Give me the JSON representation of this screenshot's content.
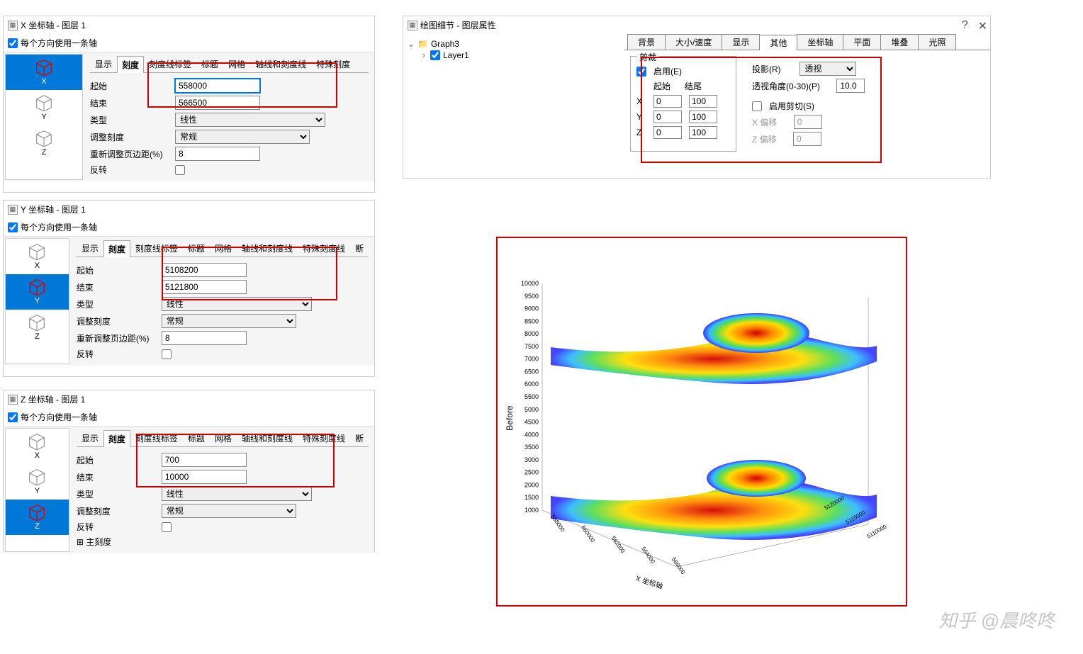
{
  "dialogs": {
    "x": {
      "title": "X 坐标轴 - 图层 1",
      "use_one": "每个方向使用一条轴",
      "axes": [
        "X",
        "Y",
        "Z"
      ],
      "selected": "X",
      "tabs": [
        "显示",
        "刻度",
        "刻度线标签",
        "标题",
        "网格",
        "轴线和刻度线",
        "特殊刻度"
      ],
      "active_tab": "刻度",
      "start_lbl": "起始",
      "start": "558000",
      "end_lbl": "结束",
      "end": "566500",
      "type_lbl": "类型",
      "type": "线性",
      "adjust_lbl": "调整刻度",
      "adjust": "常规",
      "margin_lbl": "重新调整页边距(%)",
      "margin": "8",
      "reverse_lbl": "反转"
    },
    "y": {
      "title": "Y 坐标轴 - 图层 1",
      "use_one": "每个方向使用一条轴",
      "axes": [
        "X",
        "Y",
        "Z"
      ],
      "selected": "Y",
      "tabs": [
        "显示",
        "刻度",
        "刻度线标签",
        "标题",
        "网格",
        "轴线和刻度线",
        "特殊刻度线",
        "断"
      ],
      "active_tab": "刻度",
      "start_lbl": "起始",
      "start": "5108200",
      "end_lbl": "结束",
      "end": "5121800",
      "type_lbl": "类型",
      "type": "线性",
      "adjust_lbl": "调整刻度",
      "adjust": "常规",
      "margin_lbl": "重新调整页边距(%)",
      "margin": "8",
      "reverse_lbl": "反转"
    },
    "z": {
      "title": "Z 坐标轴 - 图层 1",
      "use_one": "每个方向使用一条轴",
      "axes": [
        "X",
        "Y",
        "Z"
      ],
      "selected": "Z",
      "tabs": [
        "显示",
        "刻度",
        "刻度线标签",
        "标题",
        "网格",
        "轴线和刻度线",
        "特殊刻度线",
        "断"
      ],
      "active_tab": "刻度",
      "start_lbl": "起始",
      "start": "700",
      "end_lbl": "结束",
      "end": "10000",
      "type_lbl": "类型",
      "type": "线性",
      "adjust_lbl": "调整刻度",
      "adjust": "常规",
      "reverse_lbl": "反转",
      "major_lbl": "主刻度"
    }
  },
  "prop": {
    "title": "绘图细节 - 图层属性",
    "tree": {
      "root": "Graph3",
      "child": "Layer1"
    },
    "tabs": [
      "背景",
      "大小/速度",
      "显示",
      "其他",
      "坐标轴",
      "平面",
      "堆叠",
      "光照"
    ],
    "active": "其他",
    "clip": {
      "label": "剪裁",
      "enable": "启用(E)",
      "start": "起始",
      "end": "结尾",
      "x": "X",
      "y": "Y",
      "z": "Z",
      "xstart": "0",
      "xend": "100",
      "ystart": "0",
      "yend": "100",
      "zstart": "0",
      "zend": "100"
    },
    "projection": {
      "label": "投影(R)",
      "value": "透视"
    },
    "persp_angle": {
      "label": "透视角度(0-30)(P)",
      "value": "10.0"
    },
    "shear": {
      "enable": "启用剪切(S)",
      "xoff_lbl": "X 偏移",
      "xoff": "0",
      "zoff_lbl": "Z 偏移",
      "zoff": "0"
    }
  },
  "chart_data": {
    "type": "3d-surface-stack",
    "title": "",
    "zlabel": "Before",
    "z_ticks": [
      1000,
      1500,
      2000,
      2500,
      3000,
      3500,
      4000,
      4500,
      5000,
      5500,
      6000,
      6500,
      7000,
      7500,
      8000,
      8500,
      9000,
      9500,
      10000
    ],
    "x_ticks": [
      558000,
      560000,
      562000,
      564000,
      566000
    ],
    "y_ticks": [
      5110000,
      5115000,
      5120000
    ],
    "xlabel": "X 坐标轴",
    "surfaces": 2,
    "colormap": "rainbow"
  },
  "watermark": "知乎 @晨咚咚"
}
